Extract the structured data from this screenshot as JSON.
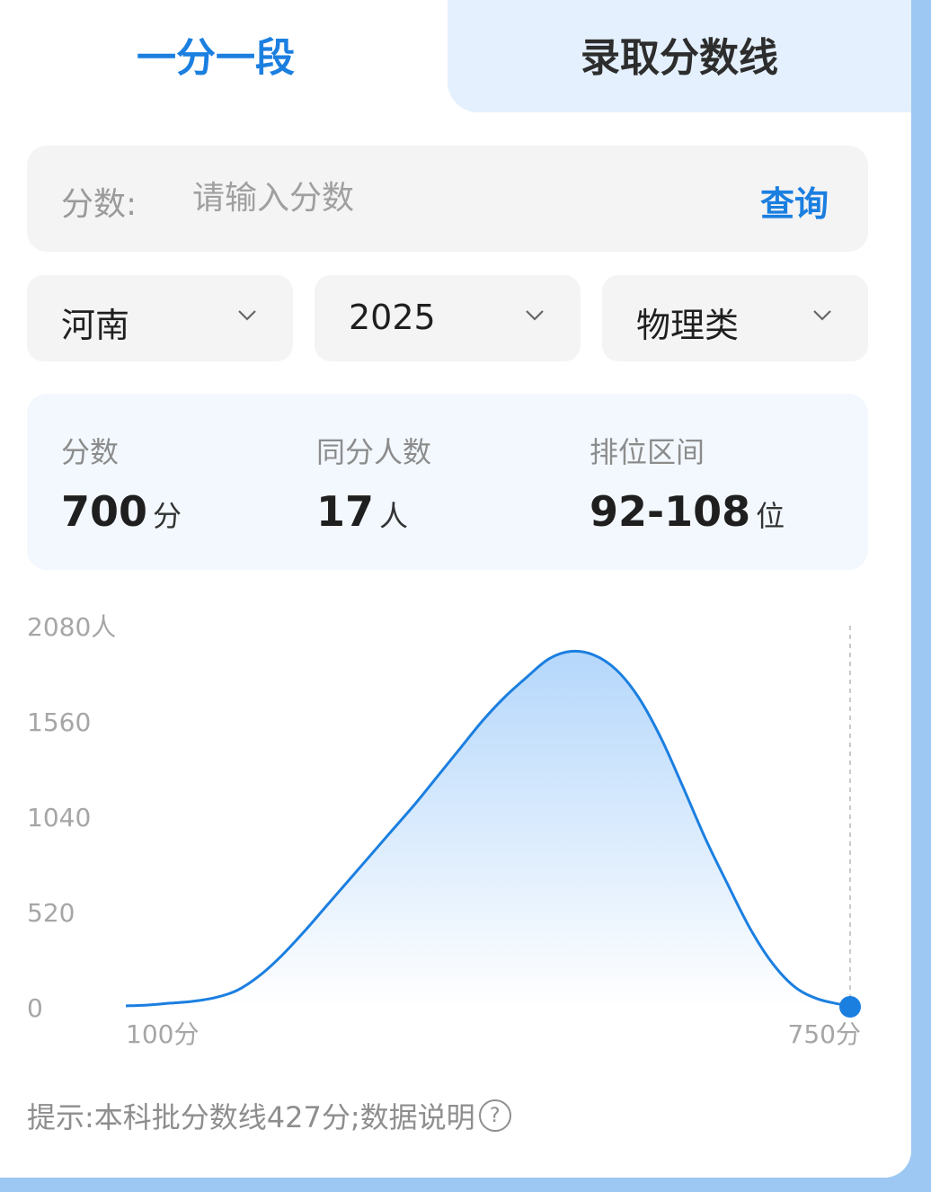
{
  "tabs": [
    {
      "label": "一分一段",
      "active": true
    },
    {
      "label": "录取分数线",
      "active": false
    }
  ],
  "search": {
    "label": "分数:",
    "placeholder": "请输入分数",
    "button": "查询"
  },
  "filters": [
    {
      "value": "河南",
      "icon": "chevron-down-icon"
    },
    {
      "value": "2025",
      "icon": "chevron-down-icon"
    },
    {
      "value": "物理类",
      "icon": "chevron-down-icon"
    }
  ],
  "stats": {
    "score": {
      "label": "分数",
      "value": "700",
      "unit": "分"
    },
    "same_count": {
      "label": "同分人数",
      "value": "17",
      "unit": "人"
    },
    "rank_range": {
      "label": "排位区间",
      "value": "92-108",
      "unit": "位"
    }
  },
  "chart_data": {
    "type": "area",
    "y_ticks": [
      "2080人",
      "1560",
      "1040",
      "520",
      "0"
    ],
    "y_tick_values": [
      2080,
      1560,
      1040,
      520,
      0
    ],
    "x_tick_labels": [
      "100分",
      "750分"
    ],
    "xlim": [
      100,
      750
    ],
    "ylim": [
      0,
      2080
    ],
    "grid": false,
    "highlight": {
      "x": 750,
      "y": 0
    },
    "x": [
      100,
      120,
      140,
      160,
      180,
      200,
      220,
      240,
      260,
      280,
      300,
      320,
      340,
      360,
      380,
      400,
      420,
      440,
      460,
      480,
      500,
      520,
      540,
      560,
      580,
      600,
      620,
      640,
      660,
      680,
      700,
      720,
      740,
      750
    ],
    "values": [
      5,
      10,
      20,
      30,
      50,
      90,
      170,
      280,
      410,
      550,
      690,
      830,
      970,
      1110,
      1260,
      1410,
      1560,
      1690,
      1800,
      1900,
      1940,
      1920,
      1840,
      1690,
      1470,
      1200,
      920,
      670,
      430,
      240,
      110,
      45,
      15,
      5
    ],
    "colors": {
      "line": "#1b7fe0",
      "fill_top": "#b5d7fb",
      "fill_bottom": "#ffffff"
    }
  },
  "tip": {
    "text": "提示:本科批分数线427分;数据说明",
    "help_icon": "question-circle-icon"
  },
  "colors": {
    "accent": "#1b7fe0",
    "page_bg": "#9cc8f3"
  }
}
